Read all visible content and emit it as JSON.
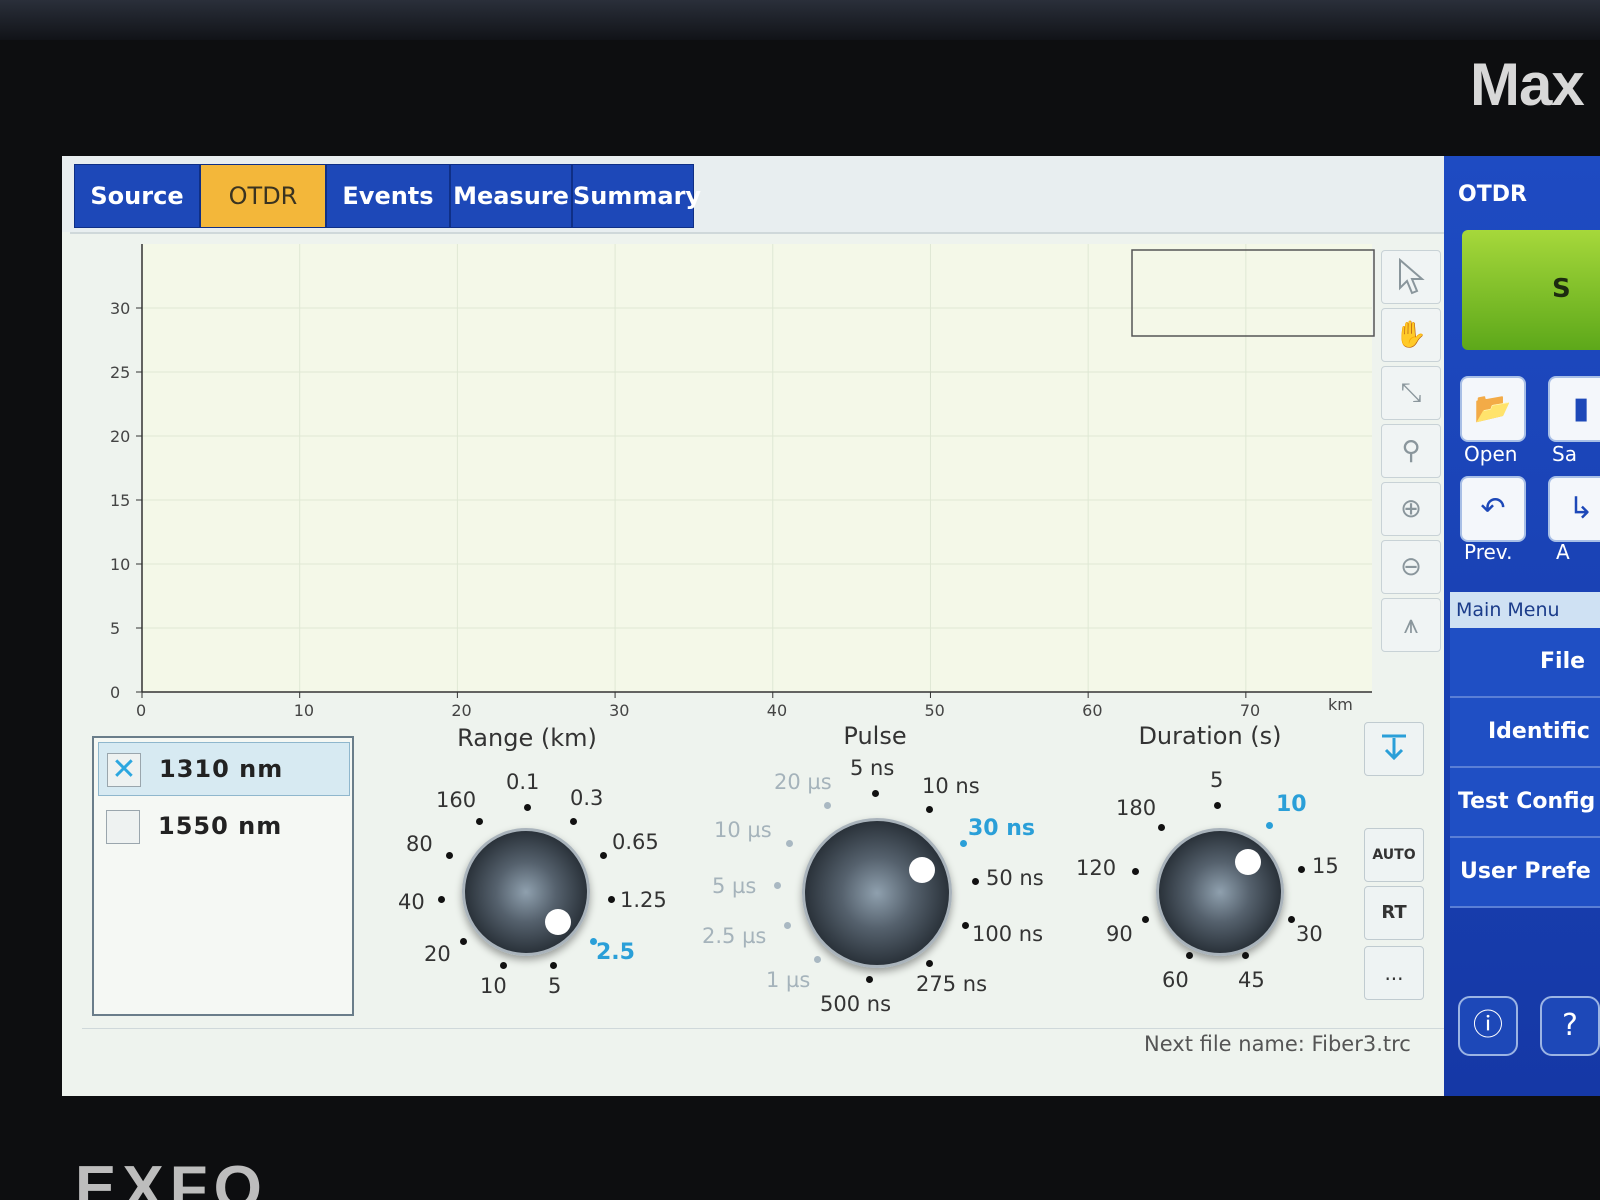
{
  "brand": {
    "top": "Max",
    "bottom": "EXFO"
  },
  "tabs": [
    {
      "label": "Source",
      "active": false
    },
    {
      "label": "OTDR",
      "active": true
    },
    {
      "label": "Events",
      "active": false
    },
    {
      "label": "Measure",
      "active": false
    },
    {
      "label": "Summary",
      "active": false
    }
  ],
  "chart_data": {
    "type": "line",
    "series": [],
    "xlabel": "km",
    "ylabel": "",
    "xlim": [
      0,
      78
    ],
    "ylim": [
      0,
      35
    ],
    "x_ticks": [
      0,
      10,
      20,
      30,
      40,
      50,
      60,
      70
    ],
    "y_ticks": [
      0,
      5,
      10,
      15,
      20,
      25,
      30
    ],
    "grid": true
  },
  "wavelengths": [
    {
      "label": "1310 nm",
      "checked": true
    },
    {
      "label": "1550 nm",
      "checked": false
    }
  ],
  "range_knob": {
    "title": "Range (km)",
    "options": [
      "0.1",
      "0.3",
      "0.65",
      "1.25",
      "2.5",
      "5",
      "10",
      "20",
      "40",
      "80",
      "160"
    ],
    "selected": "2.5"
  },
  "pulse_knob": {
    "title": "Pulse",
    "options": [
      "5 ns",
      "10 ns",
      "30 ns",
      "50 ns",
      "100 ns",
      "275 ns",
      "500 ns",
      "1 µs",
      "2.5 µs",
      "5 µs",
      "10 µs",
      "20 µs"
    ],
    "unavailable": [
      "1 µs",
      "2.5 µs",
      "5 µs",
      "10 µs",
      "20 µs"
    ],
    "selected": "30 ns"
  },
  "duration_knob": {
    "title": "Duration (s)",
    "options": [
      "5",
      "10",
      "15",
      "30",
      "45",
      "60",
      "90",
      "120",
      "180"
    ],
    "selected": "10"
  },
  "status": {
    "next_file": "Next file name: Fiber3.trc"
  },
  "side_buttons": {
    "auto": "AUTO",
    "rt": "RT",
    "more": "..."
  },
  "right_panel": {
    "title": "OTDR",
    "start_label": "S",
    "buttons": [
      {
        "label": "Open",
        "icon": "folder-icon"
      },
      {
        "label": "Sa",
        "icon": "save-icon"
      },
      {
        "label": "Prev.",
        "icon": "previous-icon"
      },
      {
        "label": "A",
        "icon": "analyze-icon"
      }
    ],
    "main_menu": "Main Menu",
    "menu_items": [
      "File",
      "Identific",
      "Test Config",
      "User Prefe"
    ]
  },
  "colors": {
    "accent_blue": "#1d48b8",
    "active_tab": "#f3b73a",
    "start_green": "#7cc22a",
    "selected_value": "#2a9fd8"
  }
}
